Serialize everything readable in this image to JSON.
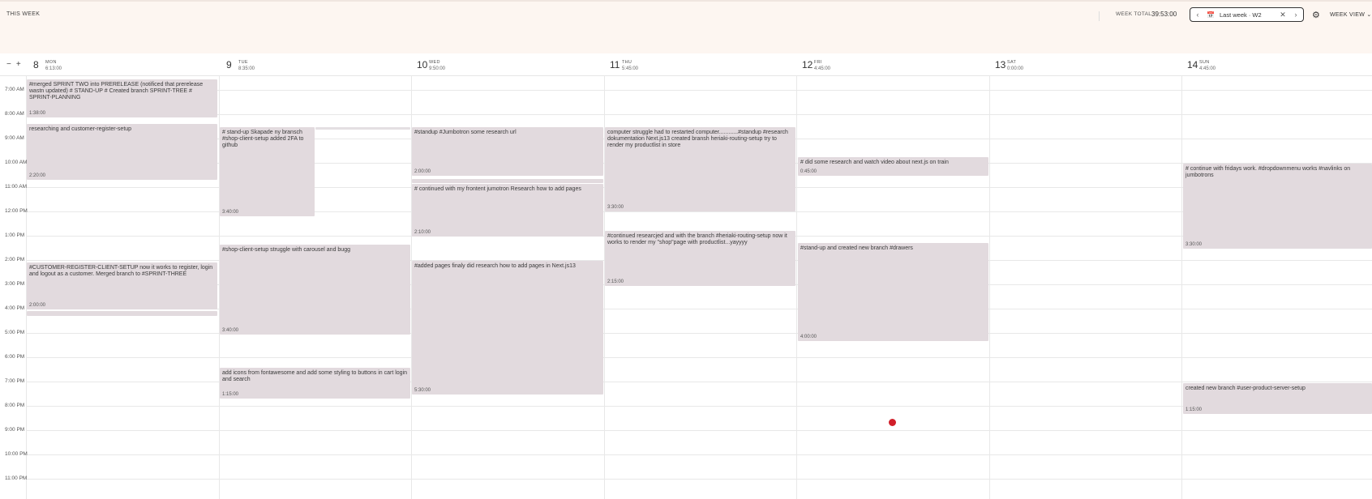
{
  "header": {
    "this_week": "THIS WEEK",
    "week_total_label": "WEEK TOTAL",
    "week_total_value": "39:53:00",
    "week_picker_label": "Last week · W2",
    "view_select": "WEEK VIEW ⌄"
  },
  "zoom": {
    "minus": "−",
    "plus": "+"
  },
  "days": [
    {
      "num": "8",
      "name": "MON",
      "total": "6:13:00"
    },
    {
      "num": "9",
      "name": "TUE",
      "total": "8:35:00"
    },
    {
      "num": "10",
      "name": "WED",
      "total": "9:50:00"
    },
    {
      "num": "11",
      "name": "THU",
      "total": "5:45:00"
    },
    {
      "num": "12",
      "name": "FRI",
      "total": "4:45:00"
    },
    {
      "num": "13",
      "name": "SAT",
      "total": "0:00:00"
    },
    {
      "num": "14",
      "name": "SUN",
      "total": "4:45:00"
    }
  ],
  "hours": [
    "7:00 AM",
    "8:00 AM",
    "9:00 AM",
    "10:00 AM",
    "11:00 AM",
    "12:00 PM",
    "1:00 PM",
    "2:00 PM",
    "3:00 PM",
    "4:00 PM",
    "5:00 PM",
    "6:00 PM",
    "7:00 PM",
    "8:00 PM",
    "9:00 PM",
    "10:00 PM",
    "11:00 PM"
  ],
  "events": [
    {
      "day": 0,
      "text": "#merged SPRINT TWO into PRERELEASE (notificed that prerelease wastn updated) # STAND-UP # Created branch SPRINT-TREE # SPRINT-PLANNING",
      "duration": "1:38:00"
    },
    {
      "day": 0,
      "text": "researching and customer-register-setup",
      "duration": "2:20:00"
    },
    {
      "day": 0,
      "text": "#CUSTOMER-REGISTER-CLIENT-SETUP now it works to register, login and logout as a customer. Merged branch to #SPRINT-THREE",
      "duration": "2:00:00"
    },
    {
      "day": 0,
      "text": "",
      "duration": ""
    },
    {
      "day": 1,
      "text": "# stand-up Skapade ny bransch #shop-client-setup added 2FA to github",
      "duration": "3:40:00"
    },
    {
      "day": 1,
      "text": "",
      "duration": ""
    },
    {
      "day": 1,
      "text": "#shop-client-setup struggle with carousel and bugg",
      "duration": "3:40:00"
    },
    {
      "day": 1,
      "text": "add icons from fontawesome and add some styling to buttons in cart login and search",
      "duration": "1:15:00"
    },
    {
      "day": 2,
      "text": "#standup #Jumbotron some research url",
      "duration": "2:00:00"
    },
    {
      "day": 2,
      "text": "",
      "duration": ""
    },
    {
      "day": 2,
      "text": "# continued with my frontent jumotron Research how to add pages",
      "duration": "2:10:00"
    },
    {
      "day": 2,
      "text": "#added pages finaly did research how to add pages in Next.js13",
      "duration": "5:30:00"
    },
    {
      "day": 3,
      "text": "computer struggle had to restarted computer............#standup #research dokumentation Next.js13 created bransh heriaki-routing-setup try to render my productlist in store",
      "duration": "3:30:00"
    },
    {
      "day": 3,
      "text": "#continued researcjed and with the branch #heriaki-routing-setup now it works to render my \"shop\"page with productlist...yayyyy",
      "duration": "2:15:00"
    },
    {
      "day": 4,
      "text": "# did some research and watch video about next.js on train",
      "duration": "0:45:00"
    },
    {
      "day": 4,
      "text": "#stand-up and created new branch #drawers",
      "duration": "4:00:00"
    },
    {
      "day": 6,
      "text": "# continue with fridays work. #dropdownmenu works #navlinks on jumbotrons",
      "duration": "3:30:00"
    },
    {
      "day": 6,
      "text": "created new branch #user-product-server-setup",
      "duration": "1:15:00"
    }
  ],
  "colors": {
    "event_bg": "#e2dade",
    "topbar_bg": "#fdf6f1",
    "now_indicator": "#d11f2a"
  },
  "icons": {
    "calendar": "calendar-icon",
    "settings": "gear-icon",
    "prev": "chevron-left-icon",
    "next": "chevron-right-icon",
    "clear": "close-icon"
  }
}
